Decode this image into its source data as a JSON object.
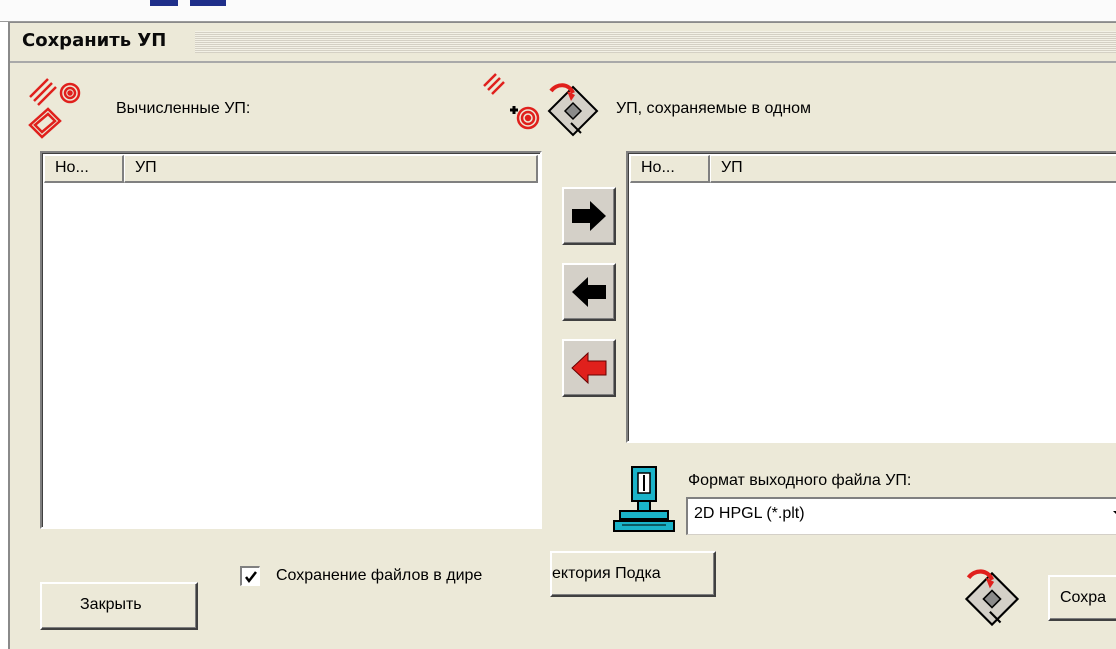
{
  "dialog": {
    "title": "Сохранить УП",
    "computed_label": "Вычисленные УП:",
    "saved_label": "УП, сохраняемые в одном",
    "left_list": {
      "columns": [
        "Но...",
        "УП"
      ],
      "rows": []
    },
    "right_list": {
      "columns": [
        "Но...",
        "УП"
      ],
      "rows": []
    },
    "format_label": "Формат выходного файла УП:",
    "format_value": "2D HPGL (*.plt)",
    "save_to_dir_label": "Сохранение файлов в дире",
    "save_to_dir_checked": true,
    "directory_button": "ектория Подка",
    "close_button": "Закрыть",
    "save_button": "Сохра"
  },
  "icons": {
    "computed": "toolpaths-red-icon",
    "add_path": "add-toolpath-icon",
    "save_disk": "floppy-save-icon",
    "move_right": "arrow-right-icon",
    "move_left": "arrow-left-icon",
    "move_left_all": "arrow-left-red-icon",
    "machine": "cnc-machine-icon",
    "dropdown": "chevron-down-icon",
    "checkmark": "checkmark-icon"
  },
  "colors": {
    "dialog_bg": "#ece9d8",
    "accent_red": "#e0201c",
    "machine_cyan": "#1ab3c9"
  }
}
